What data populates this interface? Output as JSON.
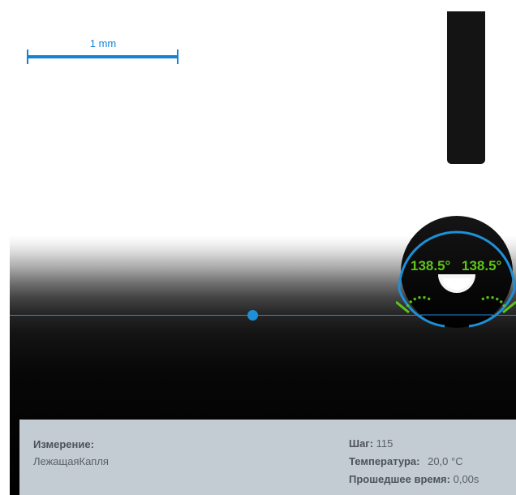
{
  "scale": {
    "label": "1 mm"
  },
  "angles": {
    "left": "138.5°",
    "right": "138.5°"
  },
  "info": {
    "measurement_label": "Измерение:",
    "measurement_value": "ЛежащаяКапля",
    "step_label": "Шаг:",
    "step_value": "115",
    "temperature_label": "Температура:",
    "temperature_value": "20,0 °C",
    "elapsed_label": "Прошедшее время:",
    "elapsed_value": "0,00s"
  },
  "colors": {
    "accent_blue": "#1e90d8",
    "angle_green": "#5ec41a",
    "panel_bg": "#c3ccd3"
  }
}
